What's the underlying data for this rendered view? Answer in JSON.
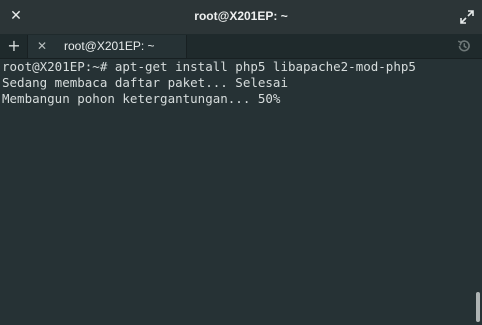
{
  "window": {
    "title": "root@X201EP: ~",
    "close_icon": "close-icon",
    "maximize_icon": "maximize-icon"
  },
  "tabs": {
    "add_icon": "plus-icon",
    "items": [
      {
        "label": "root@X201EP: ~",
        "close_icon": "close-icon"
      }
    ],
    "history_icon": "history-icon"
  },
  "terminal": {
    "lines": [
      "root@X201EP:~# apt-get install php5 libapache2-mod-php5",
      "Sedang membaca daftar paket... Selesai",
      "Membangun pohon ketergantungan... 50%"
    ]
  },
  "colors": {
    "background": "#263235",
    "text": "#d6dcdc",
    "titlebar": "#2c3537"
  }
}
